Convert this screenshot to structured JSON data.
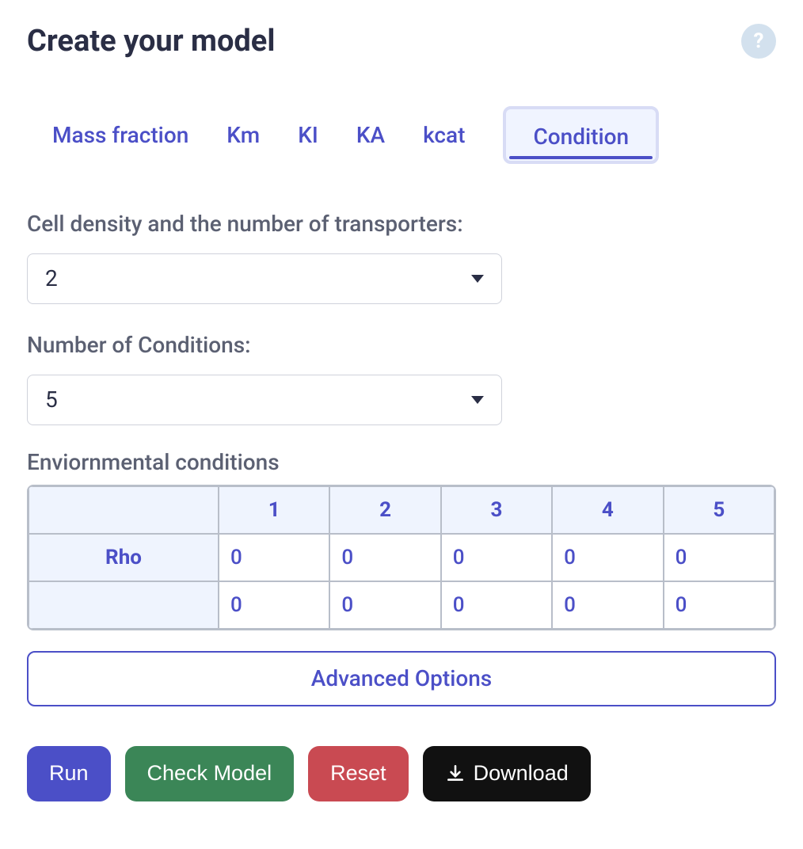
{
  "header": {
    "title": "Create your model",
    "help_icon": "?"
  },
  "tabs": [
    {
      "label": "Mass fraction",
      "active": false
    },
    {
      "label": "Km",
      "active": false
    },
    {
      "label": "KI",
      "active": false
    },
    {
      "label": "KA",
      "active": false
    },
    {
      "label": "kcat",
      "active": false
    },
    {
      "label": "Condition",
      "active": true
    }
  ],
  "fields": {
    "cell_density": {
      "label": "Cell density and the number of transporters:",
      "value": "2"
    },
    "num_conditions": {
      "label": "Number of Conditions:",
      "value": "5"
    }
  },
  "env_conditions": {
    "label": "Enviornmental conditions",
    "columns": [
      "1",
      "2",
      "3",
      "4",
      "5"
    ],
    "rows": [
      {
        "header": "Rho",
        "cells": [
          "0",
          "0",
          "0",
          "0",
          "0"
        ]
      },
      {
        "header": "",
        "cells": [
          "0",
          "0",
          "0",
          "0",
          "0"
        ]
      }
    ]
  },
  "advanced_options_label": "Advanced Options",
  "buttons": {
    "run": "Run",
    "check": "Check Model",
    "reset": "Reset",
    "download": "Download"
  }
}
